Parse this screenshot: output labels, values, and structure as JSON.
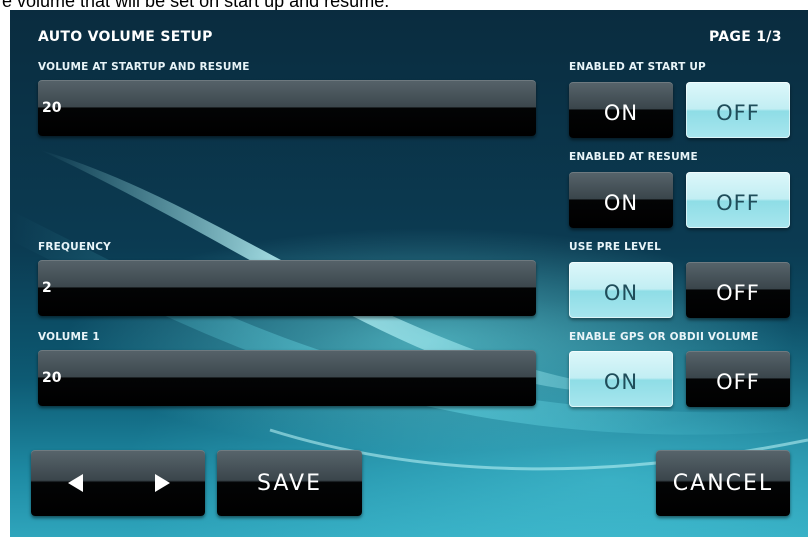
{
  "caption": "e volume that will be set on start up and resume.",
  "header": {
    "title": "AUTO VOLUME SETUP",
    "page": "PAGE 1/3"
  },
  "fields": {
    "volume_startup": {
      "label": "VOLUME AT STARTUP AND RESUME",
      "value": "20"
    },
    "frequency": {
      "label": "FREQUENCY",
      "value": "2"
    },
    "volume1": {
      "label": "VOLUME 1",
      "value": "20"
    }
  },
  "toggles": {
    "startup": {
      "label": "ENABLED AT START UP",
      "on": "ON",
      "off": "OFF",
      "selected": "OFF"
    },
    "resume": {
      "label": "ENABLED AT RESUME",
      "on": "ON",
      "off": "OFF",
      "selected": "OFF"
    },
    "pre_level": {
      "label": "USE PRE LEVEL",
      "on": "ON",
      "off": "OFF",
      "selected": "ON"
    },
    "gps_obdii": {
      "label": "ENABLE GPS OR OBDII VOLUME",
      "on": "ON",
      "off": "OFF",
      "selected": "ON"
    }
  },
  "footer": {
    "save": "SAVE",
    "cancel": "CANCEL"
  },
  "icons": {
    "prev": "left-arrow-icon",
    "next": "right-arrow-icon"
  },
  "colors": {
    "selected": "#c2eef3",
    "unselected": "#000000",
    "text": "#ffffff"
  }
}
